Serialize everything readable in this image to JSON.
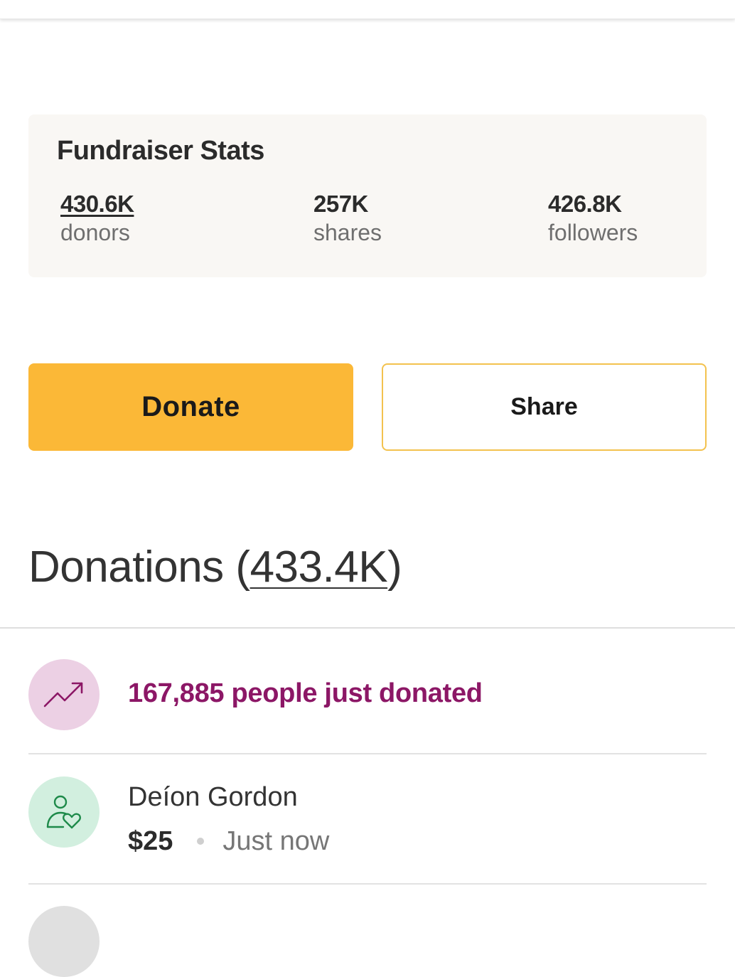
{
  "stats": {
    "title": "Fundraiser Stats",
    "items": [
      {
        "value": "430.6K",
        "label": "donors"
      },
      {
        "value": "257K",
        "label": "shares"
      },
      {
        "value": "426.8K",
        "label": "followers"
      }
    ]
  },
  "actions": {
    "donate_label": "Donate",
    "share_label": "Share"
  },
  "donations": {
    "heading": "Donations",
    "count": "433.4K",
    "trending": {
      "icon": "trending-up-icon",
      "text": "167,885 people just donated",
      "color": "#8c1766"
    },
    "list": [
      {
        "icon": "donor-heart-icon",
        "name": "Deíon Gordon",
        "amount": "$25",
        "time": "Just now"
      }
    ]
  },
  "colors": {
    "donate_button": "#fbb837",
    "share_border": "#f3c24e",
    "trend_accent": "#8c1766",
    "donor_accent": "#1e8a4a",
    "stats_background": "#f9f7f4"
  }
}
